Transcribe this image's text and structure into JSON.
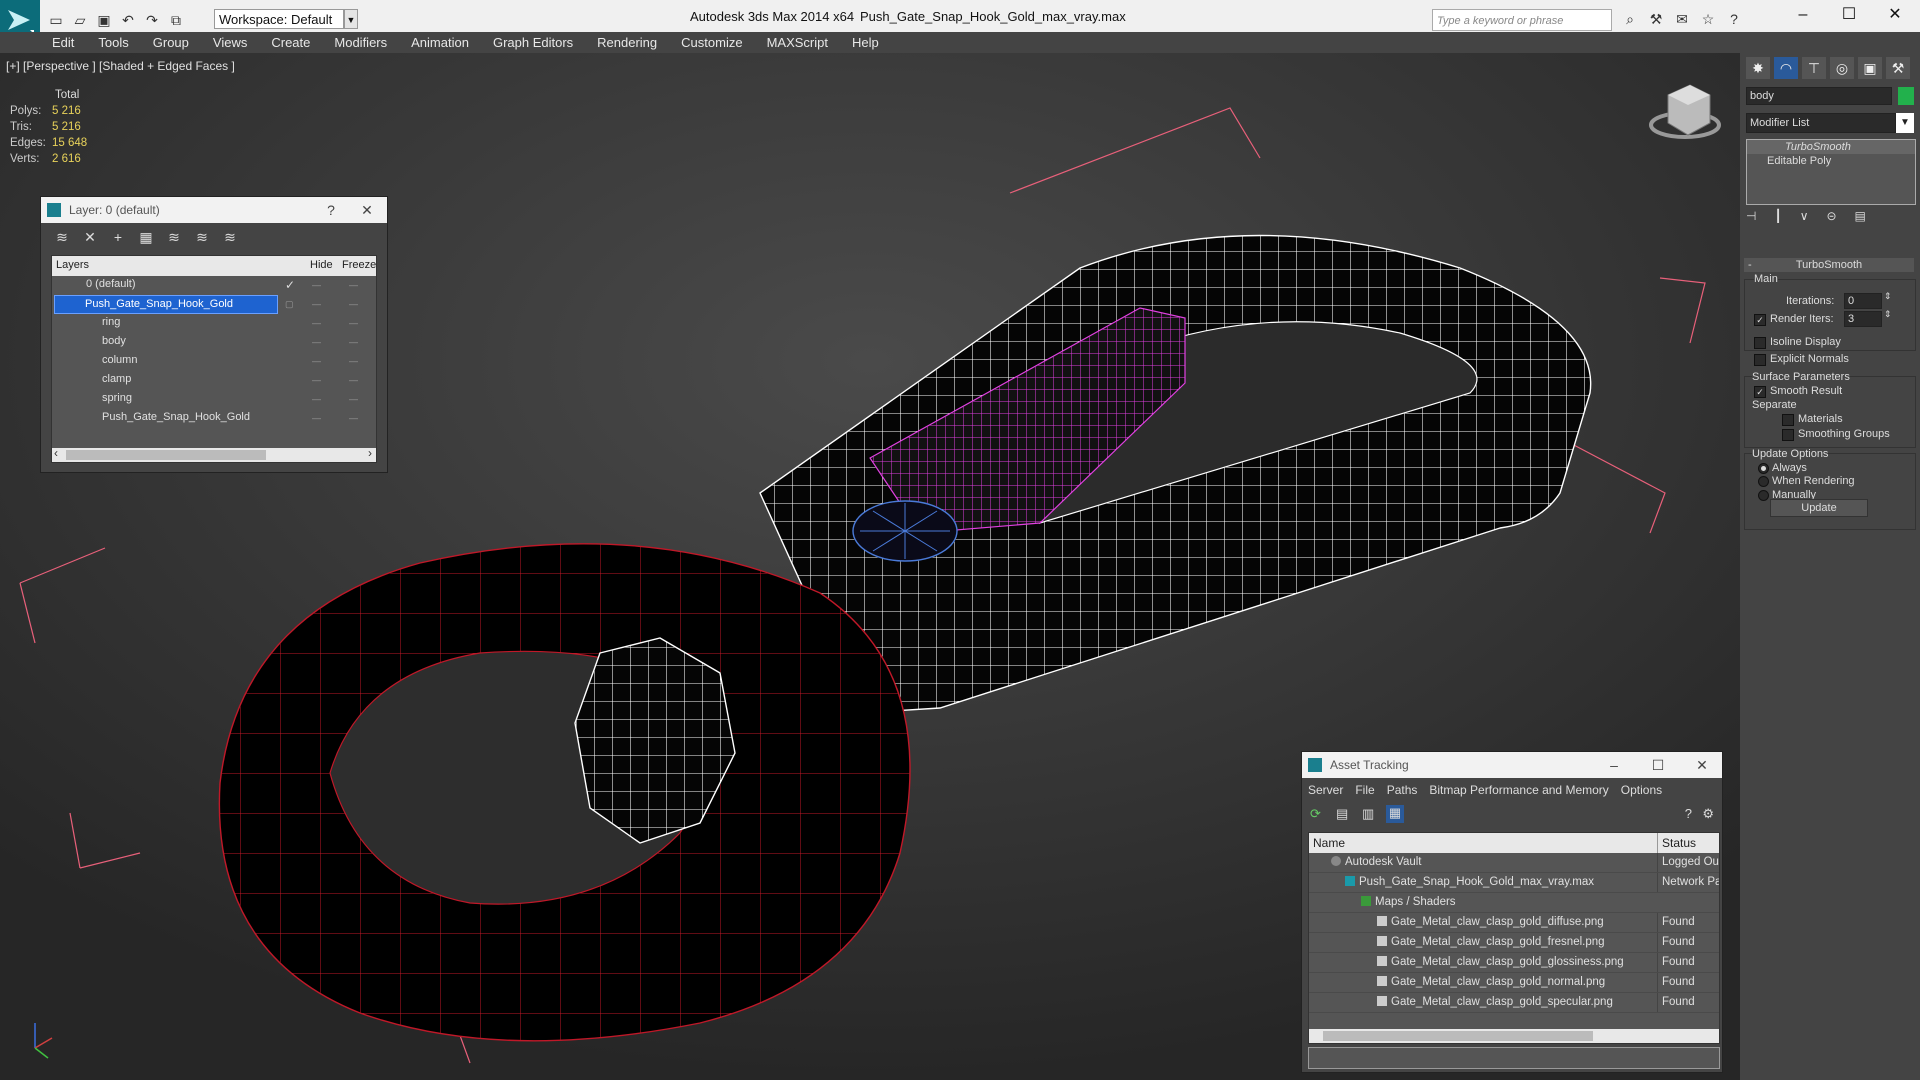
{
  "titlebar": {
    "app_title": "Autodesk 3ds Max  2014 x64",
    "file_title": "Push_Gate_Snap_Hook_Gold_max_vray.max",
    "workspace": "Workspace: Default",
    "search_placeholder": "Type a keyword or phrase",
    "minimize": "–",
    "maximize": "☐",
    "close": "✕"
  },
  "menu": [
    "Edit",
    "Tools",
    "Group",
    "Views",
    "Create",
    "Modifiers",
    "Animation",
    "Graph Editors",
    "Rendering",
    "Customize",
    "MAXScript",
    "Help"
  ],
  "viewport": {
    "label": "[+] [Perspective ] [Shaded + Edged Faces ]",
    "stats_header": "Total",
    "stats": [
      {
        "label": "Polys:",
        "value": "5 216"
      },
      {
        "label": "Tris:",
        "value": "5 216"
      },
      {
        "label": "Edges:",
        "value": "15 648"
      },
      {
        "label": "Verts:",
        "value": "2 616"
      }
    ]
  },
  "layer_dialog": {
    "title": "Layer: 0 (default)",
    "help": "?",
    "close": "✕",
    "col_layers": "Layers",
    "col_hide": "Hide",
    "col_freeze": "Freeze",
    "rows": [
      "0 (default)",
      "Push_Gate_Snap_Hook_Gold",
      "ring",
      "body",
      "column",
      "clamp",
      "spring",
      "Push_Gate_Snap_Hook_Gold"
    ],
    "check": "✓",
    "dashes": "—",
    "scroll_left": "‹",
    "scroll_right": "›"
  },
  "command_panel": {
    "object_name": "body",
    "object_color": "#22b14c",
    "modifier_list": "Modifier List",
    "stack": [
      "TurboSmooth",
      "Editable Poly"
    ],
    "rollout_title": "TurboSmooth",
    "main_label": "Main",
    "iterations_label": "Iterations:",
    "iterations_value": "0",
    "render_iters_label": "Render Iters:",
    "render_iters_value": "3",
    "isoline": "Isoline Display",
    "explicit_normals": "Explicit Normals",
    "surface_params": "Surface Parameters",
    "smooth_result": "Smooth Result",
    "separate": "Separate",
    "materials": "Materials",
    "smoothing_groups": "Smoothing Groups",
    "update_options": "Update Options",
    "always": "Always",
    "when_rendering": "When Rendering",
    "manually": "Manually",
    "update_button": "Update",
    "collapse": "-"
  },
  "asset_tracking": {
    "title": "Asset Tracking",
    "menu": [
      "Server",
      "File",
      "Paths",
      "Bitmap Performance and Memory",
      "Options"
    ],
    "col_name": "Name",
    "col_status": "Status",
    "rows": [
      {
        "name": "Autodesk Vault",
        "status": "Logged Ou"
      },
      {
        "name": "Push_Gate_Snap_Hook_Gold_max_vray.max",
        "status": "Network Pa"
      },
      {
        "name": "Maps / Shaders",
        "status": ""
      },
      {
        "name": "Gate_Metal_claw_clasp_gold_diffuse.png",
        "status": "Found"
      },
      {
        "name": "Gate_Metal_claw_clasp_gold_fresnel.png",
        "status": "Found"
      },
      {
        "name": "Gate_Metal_claw_clasp_gold_glossiness.png",
        "status": "Found"
      },
      {
        "name": "Gate_Metal_claw_clasp_gold_normal.png",
        "status": "Found"
      },
      {
        "name": "Gate_Metal_claw_clasp_gold_specular.png",
        "status": "Found"
      }
    ],
    "minimize": "–",
    "maximize": "☐",
    "close": "✕"
  }
}
